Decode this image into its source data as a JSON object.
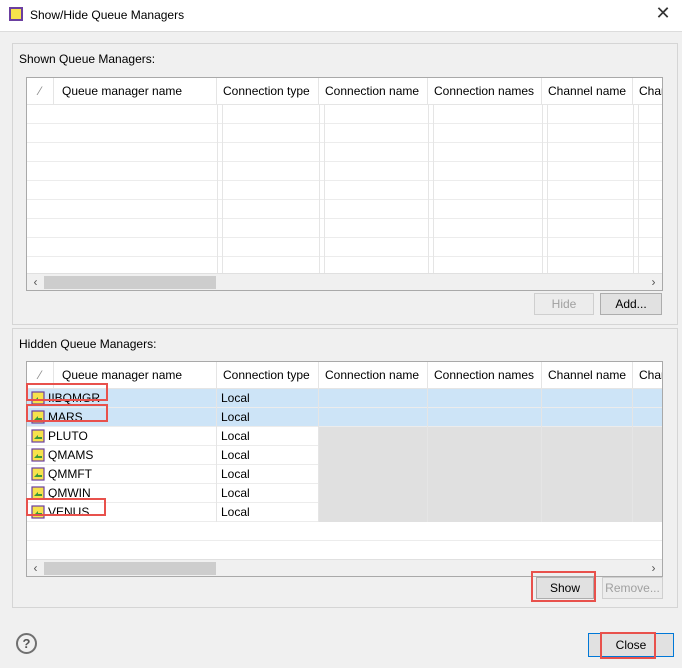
{
  "window": {
    "title": "Show/Hide Queue Managers",
    "close_glyph": "✕"
  },
  "shown_group": {
    "title": "Shown Queue Managers:",
    "columns": [
      "⁄",
      "Queue manager name",
      "Connection type",
      "Connection name",
      "Connection names",
      "Channel name",
      "Char"
    ],
    "rows": [],
    "buttons": {
      "hide": "Hide",
      "add": "Add..."
    }
  },
  "hidden_group": {
    "title": "Hidden Queue Managers:",
    "columns": [
      "⁄",
      "Queue manager name",
      "Connection type",
      "Connection name",
      "Connection names",
      "Channel name",
      "Char"
    ],
    "rows": [
      {
        "name": "IIBQMGR",
        "type": "Local",
        "selected": true
      },
      {
        "name": "MARS",
        "type": "Local",
        "selected": true
      },
      {
        "name": "PLUTO",
        "type": "Local",
        "selected": false
      },
      {
        "name": "QMAMS",
        "type": "Local",
        "selected": false
      },
      {
        "name": "QMMFT",
        "type": "Local",
        "selected": false
      },
      {
        "name": "QMWIN",
        "type": "Local",
        "selected": false
      },
      {
        "name": "VENUS",
        "type": "Local",
        "selected": false
      }
    ],
    "buttons": {
      "show": "Show",
      "remove": "Remove..."
    }
  },
  "footer": {
    "help_glyph": "?",
    "close": "Close"
  },
  "icons": {
    "window": "queue-manager-window-icon",
    "queue_manager": "queue-manager-icon",
    "help": "help-icon",
    "scroll_left": "scroll-left-icon",
    "scroll_right": "scroll-right-icon"
  },
  "colors": {
    "selection": "#cde4f7",
    "highlight": "#e8514c",
    "accent": "#0078d7"
  }
}
